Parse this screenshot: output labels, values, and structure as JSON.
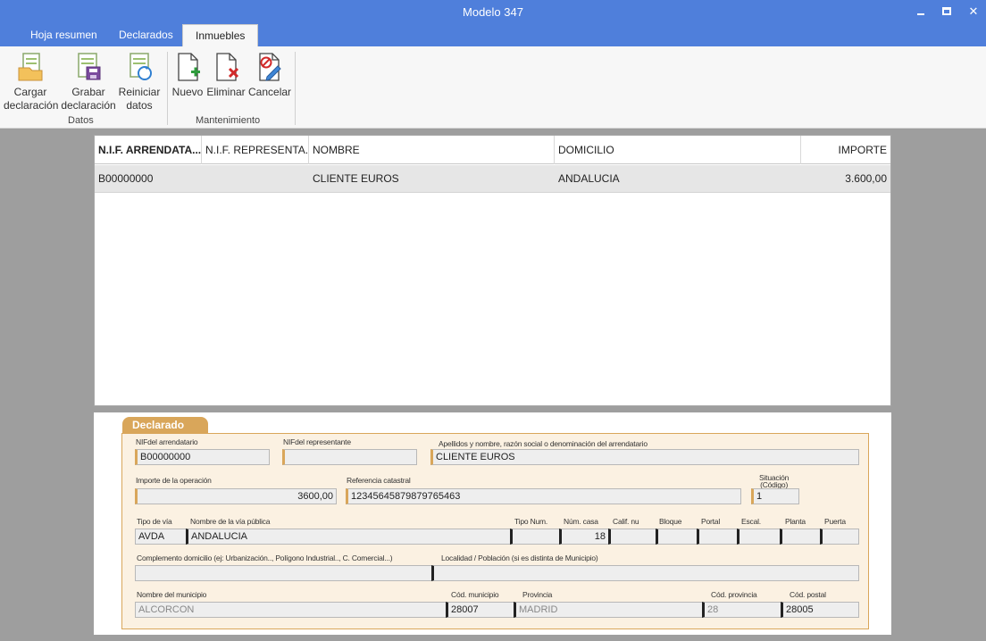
{
  "window": {
    "title": "Modelo 347"
  },
  "tabs": [
    {
      "label": "Hoja resumen"
    },
    {
      "label": "Declarados"
    },
    {
      "label": "Inmuebles"
    }
  ],
  "ribbon": {
    "cargar": {
      "line1": "Cargar",
      "line2": "declaración",
      "icon": "load-document-icon"
    },
    "grabar": {
      "line1": "Grabar",
      "line2": "declaración",
      "icon": "save-document-icon"
    },
    "reiniciar": {
      "line1": "Reiniciar",
      "line2": "datos",
      "icon": "reset-data-icon"
    },
    "nuevo": {
      "label": "Nuevo",
      "icon": "new-document-icon"
    },
    "eliminar": {
      "label": "Eliminar",
      "icon": "delete-document-icon"
    },
    "cancelar": {
      "label": "Cancelar",
      "icon": "cancel-edit-icon"
    },
    "groups": {
      "datos": "Datos",
      "mantenimiento": "Mantenimiento"
    }
  },
  "grid": {
    "columns": [
      "N.I.F. ARRENDATA...",
      "N.I.F. REPRESENTA...",
      "NOMBRE",
      "DOMICILIO",
      "IMPORTE"
    ],
    "rows": [
      {
        "nif_arrendatario": "B00000000",
        "nif_representante": "",
        "nombre": "CLIENTE EUROS",
        "domicilio": "ANDALUCIA",
        "importe": "3.600,00"
      }
    ]
  },
  "declarado": {
    "tab_label": "Declarado",
    "labels": {
      "nif_arrendatario": "NIFdel arrendatario",
      "nif_representante": "NIFdel representante",
      "apellidos": "Apellidos y nombre, razón social o denominación del arrendatario",
      "importe": "Importe de la operación",
      "ref_catastral": "Referencia catastral",
      "situacion_1": "Situación",
      "situacion_2": "(Código)",
      "tipo_via": "Tipo de vía",
      "nombre_via": "Nombre de la vía pública",
      "tipo_num": "Tipo Num.",
      "num_casa": "Núm. casa",
      "calif": "Calif. nu",
      "bloque": "Bloque",
      "portal": "Portal",
      "escal": "Escal.",
      "planta": "Planta",
      "puerta": "Puerta",
      "complemento": "Complemento domicilio (ej: Urbanización.., Polígono Industrial.., C. Comercial...)",
      "localidad": "Localidad / Población (si es distinta de Municipio)",
      "municipio": "Nombre del municipio",
      "cod_municipio": "Cód. municipio",
      "provincia": "Provincia",
      "cod_provincia": "Cód. provincia",
      "cod_postal": "Cód. postal"
    },
    "values": {
      "nif_arrendatario": "B00000000",
      "nif_representante": "",
      "apellidos": "CLIENTE EUROS",
      "importe": "3600,00",
      "ref_catastral": "12345645879879765463",
      "situacion": "1",
      "tipo_via": "AVDA",
      "nombre_via": "ANDALUCIA",
      "tipo_num": "",
      "num_casa": "18",
      "calif": "",
      "bloque": "",
      "portal": "",
      "escal": "",
      "planta": "",
      "puerta": "",
      "complemento": "",
      "localidad": "",
      "municipio": "ALCORCON",
      "cod_municipio": "28007",
      "provincia": "MADRID",
      "cod_provincia": "28",
      "cod_postal": "28005"
    }
  }
}
